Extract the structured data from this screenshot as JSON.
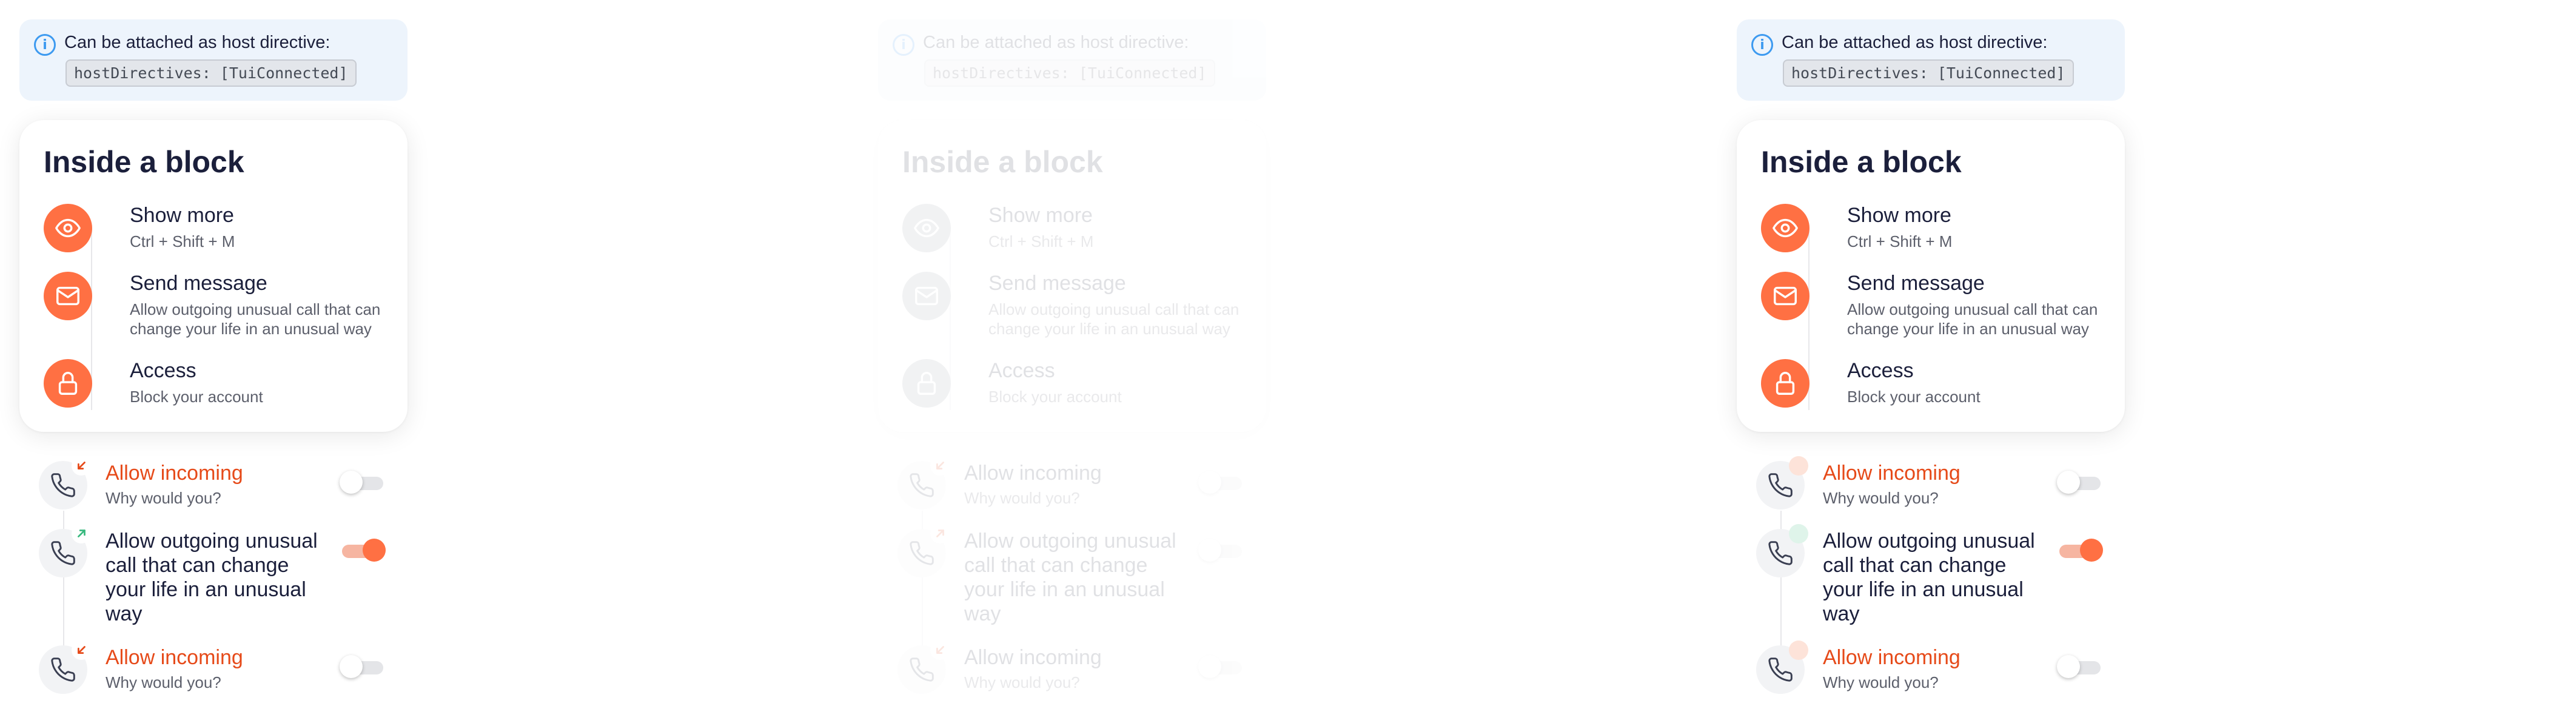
{
  "colors": {
    "accent": "#ff7043",
    "info": "#3d9af0",
    "incoming_arrow": "#e64a19",
    "outgoing_arrow": "#39b97f"
  },
  "note": {
    "text": "Can be attached as host directive:",
    "code": "hostDirectives: [TuiConnected]",
    "icon": "info-icon"
  },
  "card": {
    "title": "Inside a block",
    "items": [
      {
        "title": "Show more",
        "subtitle": "Ctrl + Shift + M",
        "icon": "eye-icon"
      },
      {
        "title": "Send message",
        "subtitle": "Allow outgoing unusual call that can change your life in an unusual way",
        "icon": "mail-icon"
      },
      {
        "title": "Access",
        "subtitle": "Block your account",
        "icon": "lock-icon"
      }
    ]
  },
  "calls": [
    {
      "title": "Allow incoming",
      "subtitle": "Why would you?",
      "direction": "incoming",
      "toggle_on": false
    },
    {
      "title": "Allow outgoing unusual call that can change your life in an unusual way",
      "subtitle": "",
      "direction": "outgoing",
      "toggle_on": true
    },
    {
      "title": "Allow incoming",
      "subtitle": "Why would you?",
      "direction": "incoming",
      "toggle_on": false
    }
  ]
}
